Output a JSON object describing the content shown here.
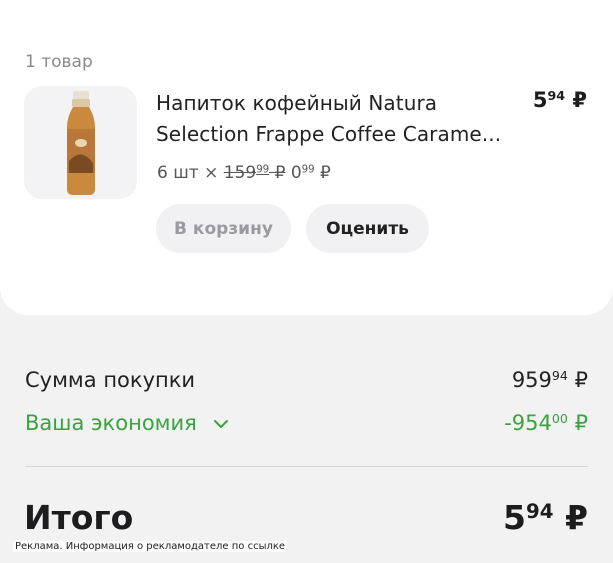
{
  "order": {
    "count_label": "1 товар"
  },
  "item": {
    "title_line1": "Напиток кофейный Natura",
    "title_line2": "Selection Frappe Coffee Carame...",
    "total_int": "5",
    "total_frac": "94",
    "currency": "₽",
    "qty": "6 шт",
    "times": "×",
    "old_price_int": "159",
    "old_price_frac": "99",
    "new_price_int": "0",
    "new_price_frac": "99",
    "image_icon": "coffee-bottle"
  },
  "buttons": {
    "cart": "В корзину",
    "rate": "Оценить"
  },
  "summary": {
    "sum_label": "Сумма покупки",
    "sum_int": "959",
    "sum_frac": "94",
    "savings_label": "Ваша экономия",
    "savings_int": "-954",
    "savings_frac": "00",
    "total_label": "Итого",
    "total_int": "5",
    "total_frac": "94",
    "currency": "₽"
  },
  "ad": {
    "note": "Реклама. Информация о рекламодателе по ссылке"
  },
  "colors": {
    "savings_green": "#3aa33e",
    "card_bg": "#ffffff",
    "page_bg": "#f2f2f3"
  }
}
